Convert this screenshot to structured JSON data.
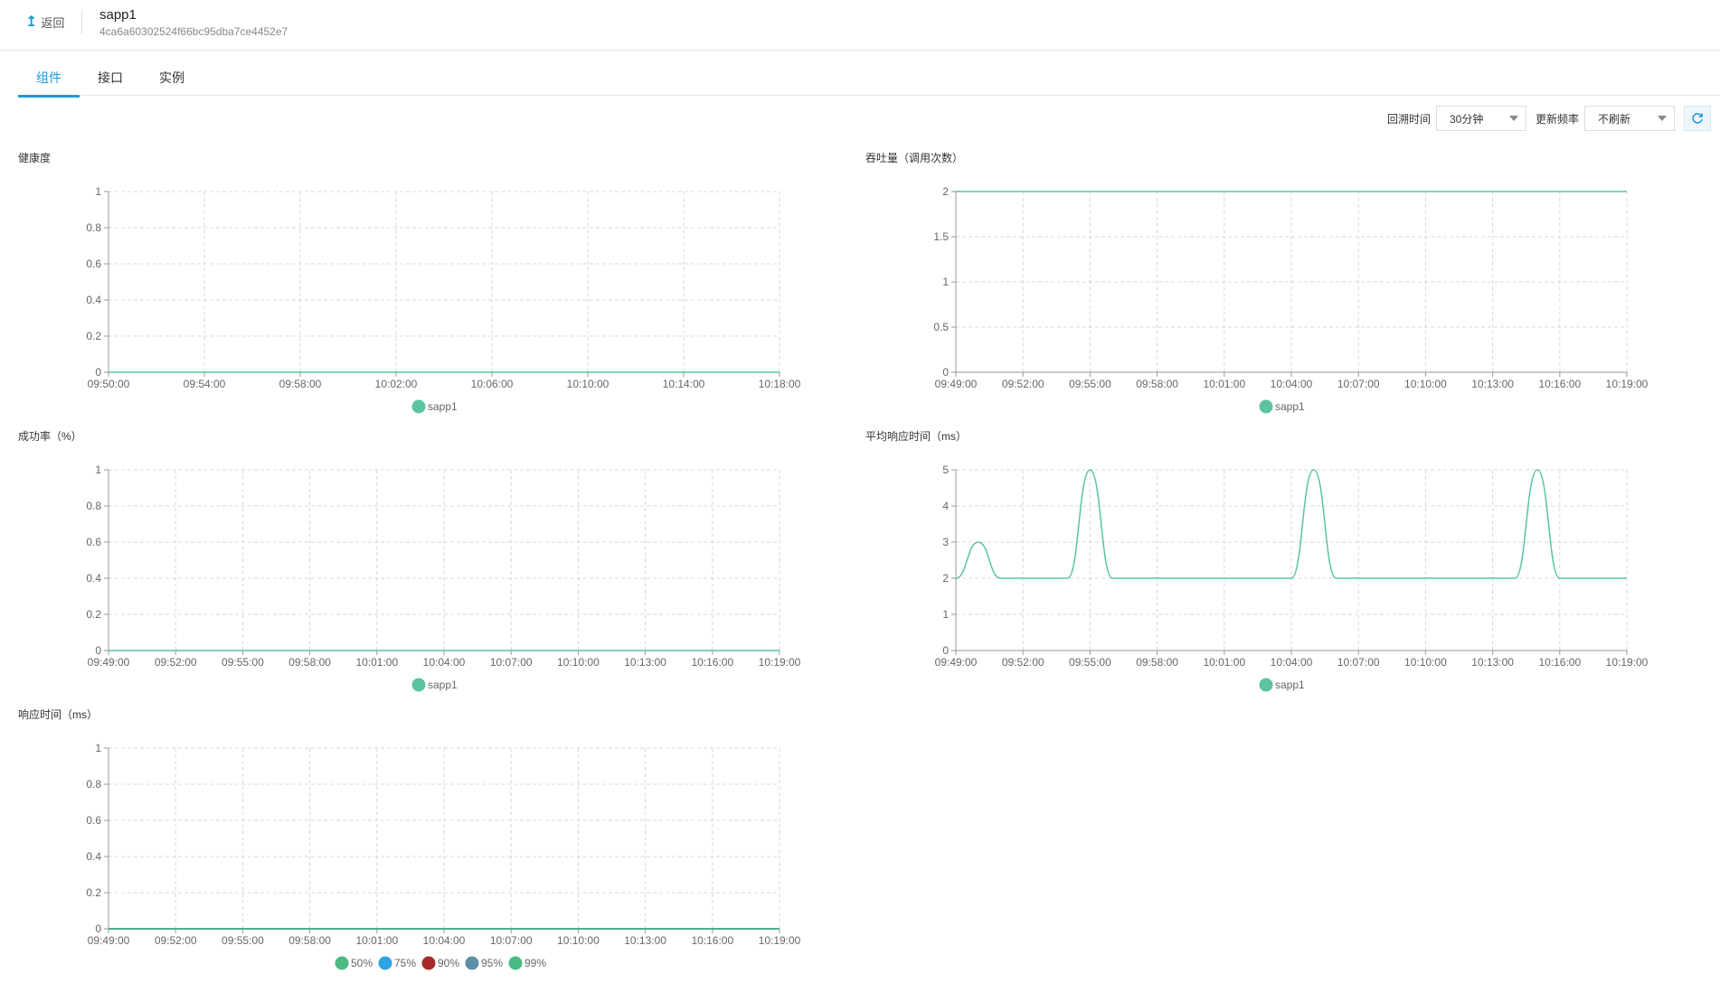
{
  "header": {
    "back_label": "返回",
    "title": "sapp1",
    "subtitle": "4ca6a60302524f66bc95dba7ce4452e7"
  },
  "tabs": [
    {
      "label": "组件",
      "active": true
    },
    {
      "label": "接口",
      "active": false
    },
    {
      "label": "实例",
      "active": false
    }
  ],
  "toolbar": {
    "lookback_label": "回溯时间",
    "lookback_value": "30分钟",
    "refresh_label": "更新频率",
    "refresh_value": "不刷新"
  },
  "colors": {
    "accent": "#1a9ad6",
    "series_green": "#5bc49f",
    "legend_50": "#4cba83",
    "legend_75": "#2ea3e0",
    "legend_90": "#a52a2a",
    "legend_95": "#5f8ea7",
    "legend_99": "#4cba83"
  },
  "chart_data": [
    {
      "id": "health",
      "type": "line",
      "title": "健康度",
      "x": [
        "09:50:00",
        "09:54:00",
        "09:58:00",
        "10:02:00",
        "10:06:00",
        "10:10:00",
        "10:14:00",
        "10:18:00"
      ],
      "yticks": [
        "0",
        "0.2",
        "0.4",
        "0.6",
        "0.8",
        "1"
      ],
      "ylim": [
        0,
        1
      ],
      "grid": true,
      "legend_position": "bottom",
      "series": [
        {
          "name": "sapp1",
          "color": "#5bc49f",
          "values": [
            0,
            0,
            0,
            0,
            0,
            0,
            0,
            0
          ]
        }
      ]
    },
    {
      "id": "throughput",
      "type": "line",
      "title": "吞吐量（调用次数）",
      "x": [
        "09:49:00",
        "09:52:00",
        "09:55:00",
        "09:58:00",
        "10:01:00",
        "10:04:00",
        "10:07:00",
        "10:10:00",
        "10:13:00",
        "10:16:00",
        "10:19:00"
      ],
      "yticks": [
        "0",
        "0.5",
        "1",
        "1.5",
        "2"
      ],
      "ylim": [
        0,
        2
      ],
      "grid": true,
      "legend_position": "bottom",
      "series": [
        {
          "name": "sapp1",
          "color": "#5bc49f",
          "values": [
            2,
            2,
            2,
            2,
            2,
            2,
            2,
            2,
            2,
            2,
            2
          ]
        }
      ]
    },
    {
      "id": "success",
      "type": "line",
      "title": "成功率（%）",
      "x": [
        "09:49:00",
        "09:52:00",
        "09:55:00",
        "09:58:00",
        "10:01:00",
        "10:04:00",
        "10:07:00",
        "10:10:00",
        "10:13:00",
        "10:16:00",
        "10:19:00"
      ],
      "yticks": [
        "0",
        "0.2",
        "0.4",
        "0.6",
        "0.8",
        "1"
      ],
      "ylim": [
        0,
        1
      ],
      "grid": true,
      "legend_position": "bottom",
      "series": [
        {
          "name": "sapp1",
          "color": "#5bc49f",
          "values": [
            0,
            0,
            0,
            0,
            0,
            0,
            0,
            0,
            0,
            0,
            0
          ]
        }
      ]
    },
    {
      "id": "avg_response",
      "type": "line",
      "title": "平均响应时间（ms）",
      "x": [
        "09:49:00",
        "09:52:00",
        "09:55:00",
        "09:58:00",
        "10:01:00",
        "10:04:00",
        "10:07:00",
        "10:10:00",
        "10:13:00",
        "10:16:00",
        "10:19:00"
      ],
      "yticks": [
        "0",
        "1",
        "2",
        "3",
        "4",
        "5"
      ],
      "ylim": [
        0,
        5
      ],
      "grid": true,
      "legend_position": "bottom",
      "series": [
        {
          "name": "sapp1",
          "color": "#5bc49f",
          "points": [
            [
              "09:49:00",
              2
            ],
            [
              "09:50:00",
              3
            ],
            [
              "09:51:00",
              2
            ],
            [
              "09:54:00",
              2
            ],
            [
              "09:55:00",
              5
            ],
            [
              "09:56:00",
              2
            ],
            [
              "10:04:00",
              2
            ],
            [
              "10:05:00",
              5
            ],
            [
              "10:06:00",
              2
            ],
            [
              "10:14:00",
              2
            ],
            [
              "10:15:00",
              5
            ],
            [
              "10:16:00",
              2
            ],
            [
              "10:19:00",
              2
            ]
          ]
        }
      ]
    },
    {
      "id": "response",
      "type": "line",
      "title": "响应时间（ms）",
      "x": [
        "09:49:00",
        "09:52:00",
        "09:55:00",
        "09:58:00",
        "10:01:00",
        "10:04:00",
        "10:07:00",
        "10:10:00",
        "10:13:00",
        "10:16:00",
        "10:19:00"
      ],
      "yticks": [
        "0",
        "0.2",
        "0.4",
        "0.6",
        "0.8",
        "1"
      ],
      "ylim": [
        0,
        1
      ],
      "grid": true,
      "legend_position": "bottom",
      "series": [
        {
          "name": "50%",
          "color": "#4cba83",
          "values": [
            0,
            0,
            0,
            0,
            0,
            0,
            0,
            0,
            0,
            0,
            0
          ]
        },
        {
          "name": "75%",
          "color": "#2ea3e0",
          "values": [
            0,
            0,
            0,
            0,
            0,
            0,
            0,
            0,
            0,
            0,
            0
          ]
        },
        {
          "name": "90%",
          "color": "#a52a2a",
          "values": [
            0,
            0,
            0,
            0,
            0,
            0,
            0,
            0,
            0,
            0,
            0
          ]
        },
        {
          "name": "95%",
          "color": "#5f8ea7",
          "values": [
            0,
            0,
            0,
            0,
            0,
            0,
            0,
            0,
            0,
            0,
            0
          ]
        },
        {
          "name": "99%",
          "color": "#4cba83",
          "values": [
            0,
            0,
            0,
            0,
            0,
            0,
            0,
            0,
            0,
            0,
            0
          ]
        }
      ]
    }
  ]
}
